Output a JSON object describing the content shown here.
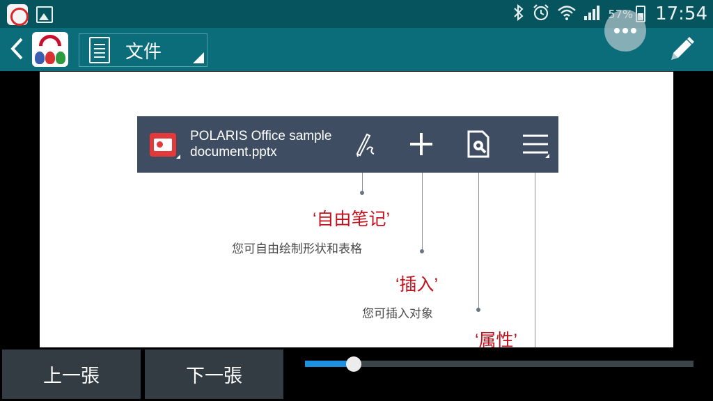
{
  "status_bar": {
    "battery_percent": "57%",
    "battery_level": 0.57,
    "time": "17:54",
    "icons": [
      "app-notification-icon",
      "gallery-icon",
      "bluetooth-icon",
      "alarm-icon",
      "wifi-icon",
      "signal-icon",
      "battery-icon"
    ]
  },
  "app_bar": {
    "back_icon": "back-arrow-icon",
    "logo_icon": "app-logo-icon",
    "document_label": "文件",
    "more_icon": "more-options-icon",
    "edit_icon": "pencil-icon"
  },
  "slide": {
    "toolbar": {
      "filename_line1": "POLARIS Office sample",
      "filename_line2": "document.pptx",
      "icons": [
        "powerpoint-file-icon",
        "free-draw-icon",
        "insert-plus-icon",
        "properties-icon",
        "menu-icon"
      ]
    },
    "callouts": [
      {
        "title": "‘自由笔记’",
        "description": "您可自由绘制形状和表格"
      },
      {
        "title": "‘插入’",
        "description": "您可插入对象"
      },
      {
        "title": "‘属性’"
      }
    ]
  },
  "bottom": {
    "prev_label": "上一張",
    "next_label": "下一張",
    "progress": 0.126
  },
  "colors": {
    "status_bar": "#06545e",
    "app_bar": "#0b6c7a",
    "slide_toolbar": "#3f4d63",
    "callout_title": "#c0111c",
    "slider_fill": "#1e90e0",
    "nav_button": "#333c42"
  }
}
